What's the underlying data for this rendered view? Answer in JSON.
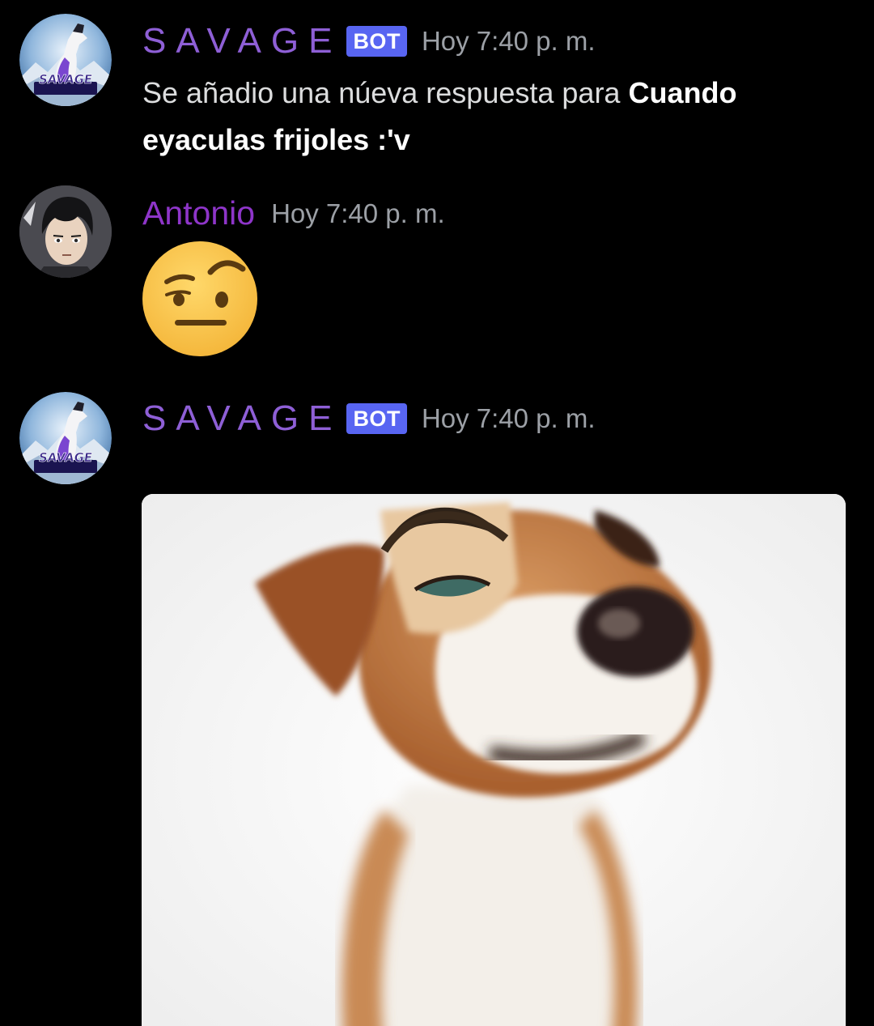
{
  "messages": [
    {
      "author": "SAVAGE",
      "bot_tag": "BOT",
      "timestamp": "Hoy 7:40 p. m.",
      "avatar_logo_text": "SAVAGE",
      "text_part1": "Se añadio una núeva respuesta para ",
      "text_bold": "Cuando eyaculas frijoles :'v"
    },
    {
      "author": "Antonio",
      "timestamp": "Hoy 7:40 p. m.",
      "emoji": "face-with-raised-eyebrow"
    },
    {
      "author": "SAVAGE",
      "bot_tag": "BOT",
      "timestamp": "Hoy 7:40 p. m.",
      "avatar_logo_text": "SAVAGE",
      "attachment": "dog-with-raised-eyebrow-meme-image"
    }
  ],
  "colors": {
    "background": "#000000",
    "bot_username": "#8e5fd6",
    "user_username": "#8e35c9",
    "bot_tag": "#5865f2",
    "timestamp": "#9ca0a6",
    "message_text": "#dcddde"
  }
}
